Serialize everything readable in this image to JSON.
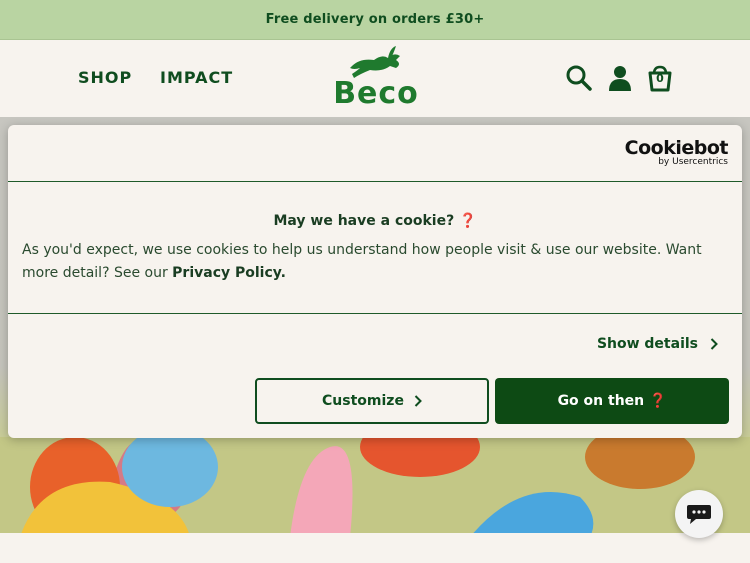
{
  "announcement": {
    "text": "Free delivery on orders £30+"
  },
  "header": {
    "nav": [
      {
        "label": "SHOP"
      },
      {
        "label": "IMPACT"
      }
    ],
    "logo_text": "Beco",
    "icons": [
      "search-icon",
      "account-icon",
      "basket-icon"
    ],
    "basket_count": "0"
  },
  "cookie_dialog": {
    "brand": {
      "name": "Cookiebot",
      "tagline": "by Usercentrics"
    },
    "title": "May we have a cookie? ❓",
    "body_prefix": "As you'd expect, we use cookies to help us understand how people visit & use our website. Want more detail? See our ",
    "privacy_link": "Privacy Policy.",
    "show_details": "Show details",
    "customize_label": "Customize",
    "accept_label": "Go on then ❓"
  },
  "colors": {
    "brand_green": "#0f4d1f",
    "announcement_bg": "#b9d4a2",
    "accept_button": "#0d4a14",
    "page_bg": "#f7f3ee"
  }
}
